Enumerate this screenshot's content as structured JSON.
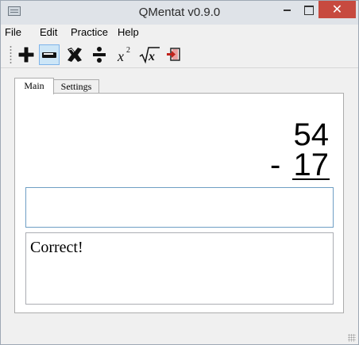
{
  "window": {
    "title": "QMentat v0.9.0"
  },
  "menu": [
    "File",
    "Edit",
    "Practice",
    "Help"
  ],
  "toolbar": {
    "tools": [
      {
        "name": "add-icon",
        "selected": false
      },
      {
        "name": "subtract-icon",
        "selected": true
      },
      {
        "name": "multiply-icon",
        "selected": false
      },
      {
        "name": "divide-icon",
        "selected": false
      },
      {
        "name": "square-icon",
        "selected": false
      },
      {
        "name": "square-root-icon",
        "selected": false
      },
      {
        "name": "exit-icon",
        "selected": false
      }
    ]
  },
  "tabs": {
    "main": "Main",
    "settings": "Settings"
  },
  "problem": {
    "top": "54",
    "operator": "-",
    "bottom": "17"
  },
  "answer": {
    "value": ""
  },
  "feedback": {
    "text": "Correct!"
  }
}
